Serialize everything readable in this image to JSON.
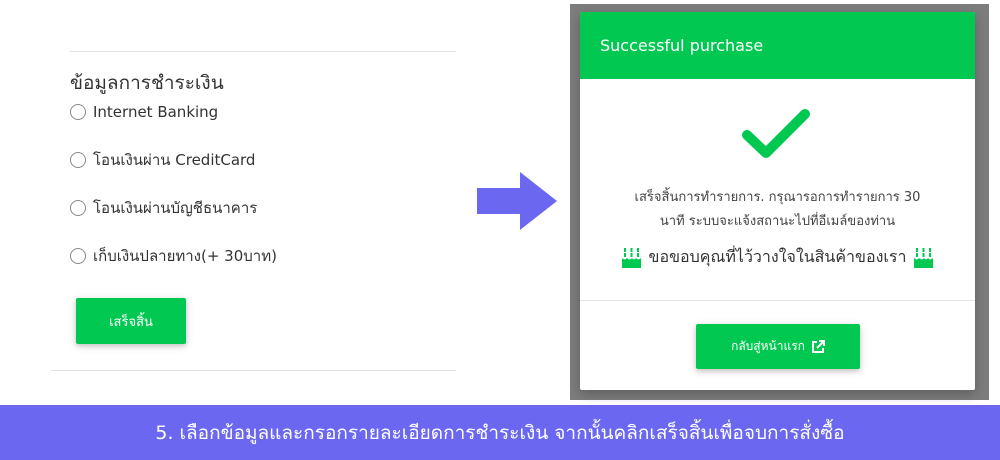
{
  "payment_form": {
    "title": "ข้อมูลการชำระเงิน",
    "options": [
      {
        "label": "Internet Banking"
      },
      {
        "label": "โอนเงินผ่าน CreditCard"
      },
      {
        "label": "โอนเงินผ่านบัญชีธนาคาร"
      },
      {
        "label": "เก็บเงินปลายทาง(+ 30บาท)"
      }
    ],
    "finish_label": "เสร็จสิ้น"
  },
  "arrow": {
    "icon": "arrow-right-icon",
    "color": "#6b67f0"
  },
  "modal": {
    "header": "Successful purchase",
    "check_icon": "checkmark-icon",
    "message_line1": "เสร็จสิ้นการทำรายการ. กรุณารอการทำรายการ 30",
    "message_line2": "นาที ระบบจะแจ้งสถานะไปที่อีเมล์ของท่าน",
    "thanks": "ขอขอบคุณที่ไว้วางใจในสินค้าของเรา",
    "thanks_icon": "birthday-cake-icon",
    "home_button": "กลับสู่หน้าแรก",
    "home_button_icon": "external-link-icon"
  },
  "caption": "5. เลือกข้อมูลและกรอกรายละเอียดการชำระเงิน จากนั้นคลิกเสร็จสิ้นเพื่อจบการสั่งซื้อ",
  "colors": {
    "accent_green": "#00c851",
    "caption_bg": "#6b67f0",
    "overlay": "#7d7d7d"
  }
}
